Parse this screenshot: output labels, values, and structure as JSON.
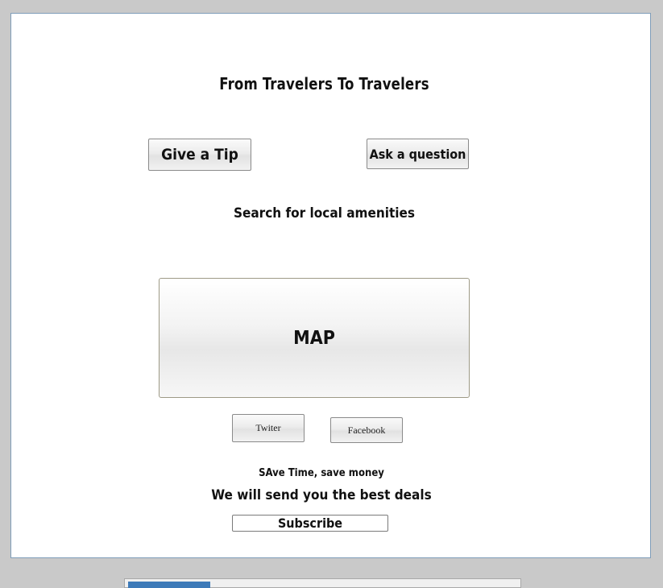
{
  "page": {
    "title": "From Travelers To Travelers"
  },
  "actions": {
    "give_tip_label": "Give a Tip",
    "ask_question_label": "Ask a question"
  },
  "search": {
    "label": "Search for local amenities"
  },
  "map": {
    "label": "MAP"
  },
  "social": {
    "twitter_label": "Twiter",
    "facebook_label": "Facebook"
  },
  "newsletter": {
    "tagline": "SAve Time, save money",
    "headline": "We will send you the best deals",
    "subscribe_label": "Subscribe"
  },
  "colors": {
    "canvas_border": "#7f9db9",
    "tab_accent": "#3d7ab8"
  }
}
